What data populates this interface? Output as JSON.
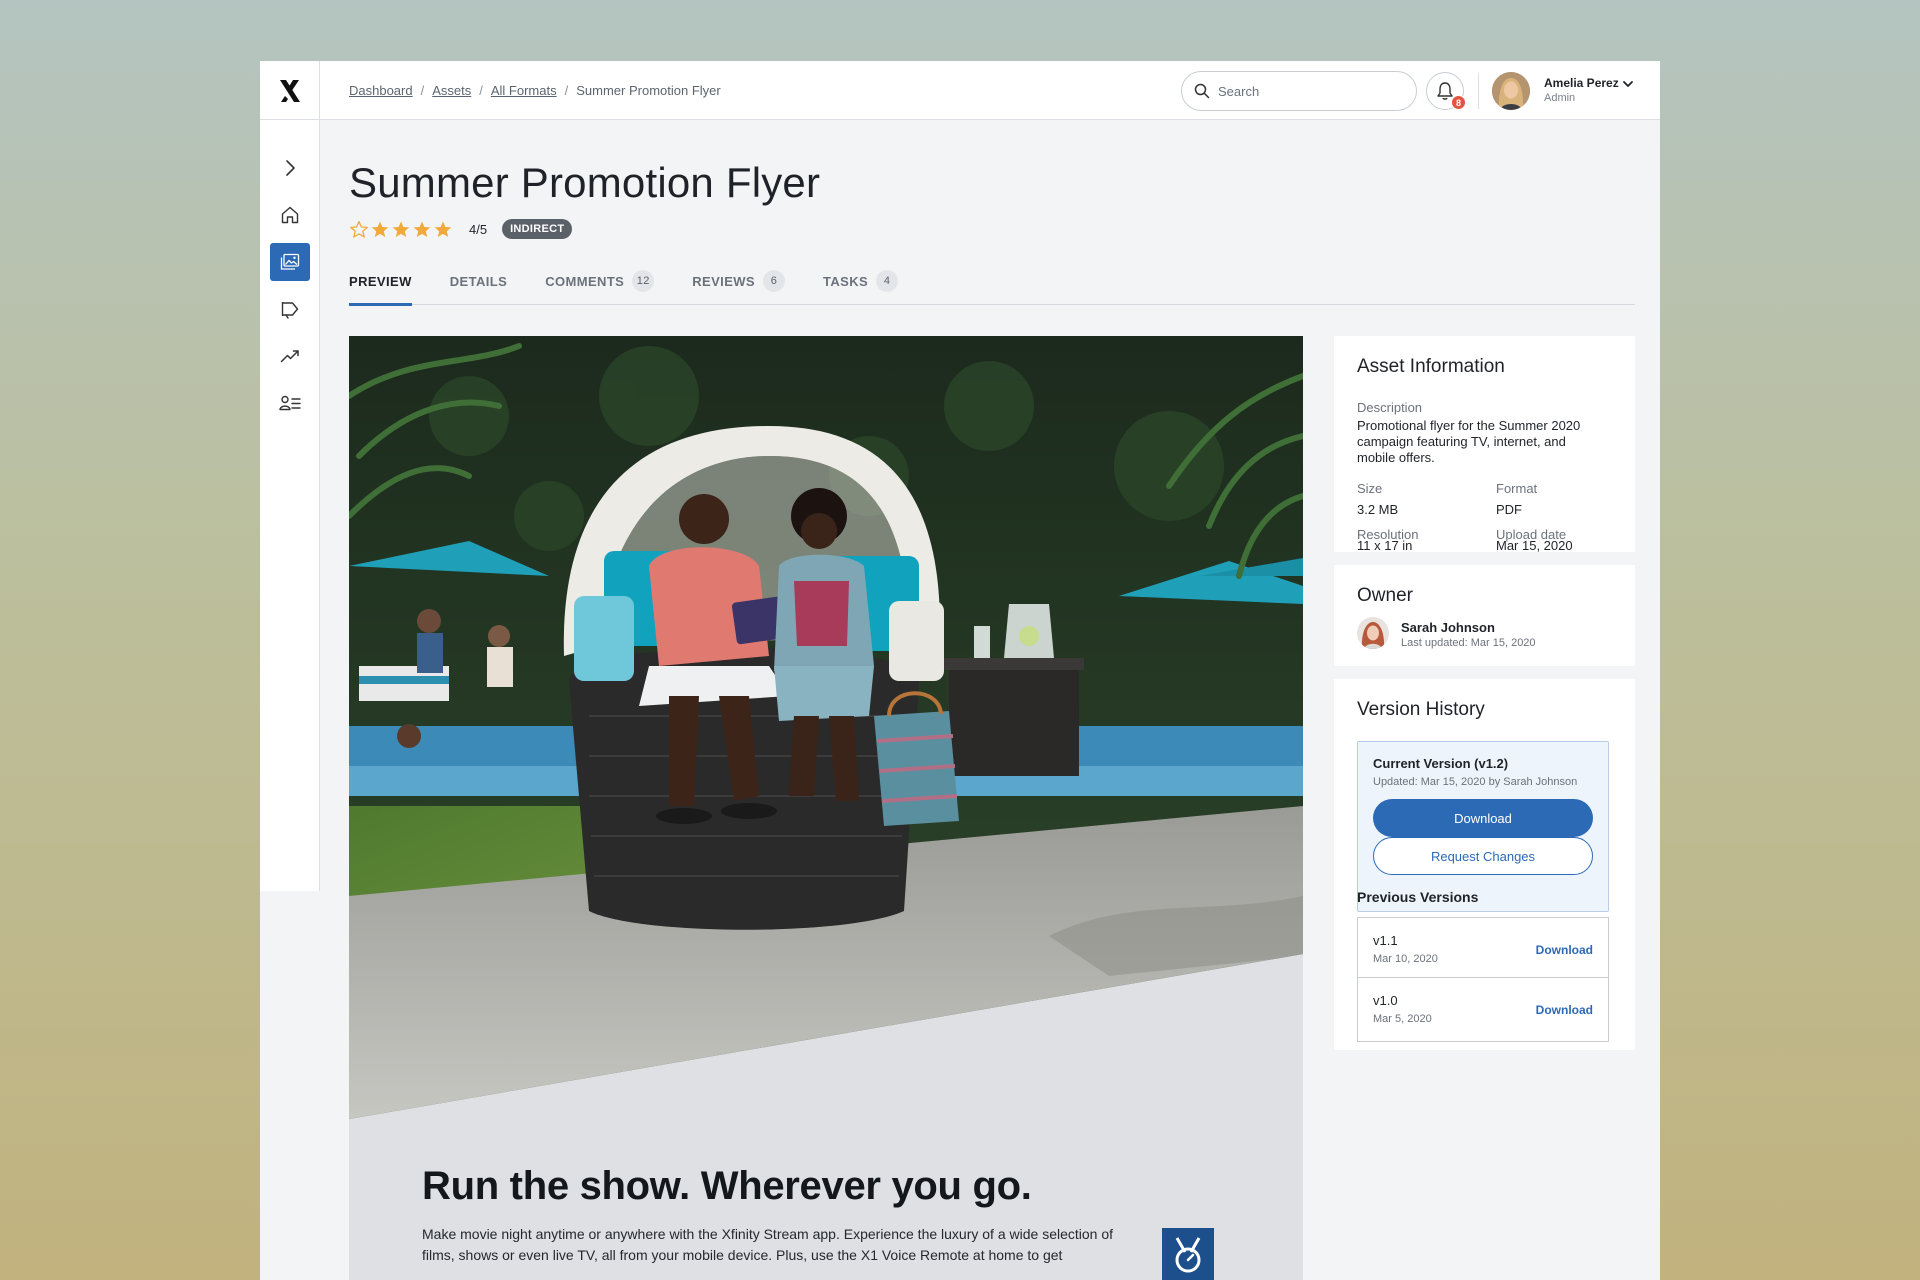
{
  "breadcrumb": {
    "items": [
      "Dashboard",
      "Assets",
      "All Formats"
    ],
    "current": "Summer Promotion Flyer",
    "separator": "/"
  },
  "search": {
    "placeholder": "Search"
  },
  "notifications": {
    "count": "8"
  },
  "user": {
    "name": "Amelia Perez",
    "role": "Admin"
  },
  "rail": {
    "items": [
      "expand-icon",
      "home-icon",
      "assets-icon",
      "campaigns-icon",
      "analytics-icon",
      "users-icon"
    ],
    "active": "assets-icon"
  },
  "asset": {
    "title": "Summer Promotion Flyer",
    "rating_text": "4/5",
    "rating_value": 4,
    "rating_max": 5,
    "badge": "INDIRECT"
  },
  "tabs": [
    {
      "label": "PREVIEW",
      "count": ""
    },
    {
      "label": "DETAILS",
      "count": ""
    },
    {
      "label": "COMMENTS",
      "count": "12"
    },
    {
      "label": "REVIEWS",
      "count": "6"
    },
    {
      "label": "TASKS",
      "count": "4"
    }
  ],
  "preview": {
    "headline": "Run the show. Wherever you go.",
    "body": "Make movie night anytime or anywhere with the Xfinity Stream app. Experience the luxury of a wide selection of films, shows or even live TV, all from your mobile device. Plus, use the X1 Voice Remote at home to get"
  },
  "asset_info": {
    "title": "Asset Information",
    "description_label": "Description",
    "description": "Promotional flyer for the Summer 2020 campaign featuring TV, internet, and mobile offers.",
    "size_label": "Size",
    "size": "3.2 MB",
    "format_label": "Format",
    "format": "PDF",
    "resolution_label": "Resolution",
    "resolution": "11 x 17 in",
    "upload_label": "Upload date",
    "upload": "Mar 15, 2020"
  },
  "owner": {
    "title": "Owner",
    "name": "Sarah Johnson",
    "updated": "Last updated: Mar 15, 2020"
  },
  "versions": {
    "title": "Version History",
    "current_label": "Current Version (v1.2)",
    "current_meta": "Updated: Mar 15, 2020 by Sarah Johnson",
    "download_label": "Download",
    "request_label": "Request Changes",
    "previous_title": "Previous Versions",
    "previous": [
      {
        "version": "v1.1",
        "date": "Mar 10, 2020",
        "action": "Download"
      },
      {
        "version": "v1.0",
        "date": "Mar 5, 2020",
        "action": "Download"
      }
    ]
  },
  "colors": {
    "accent": "#2d6ab6",
    "star": "#f2a93b",
    "badge": "#e3553f",
    "page_bg": "#f3f4f6"
  }
}
